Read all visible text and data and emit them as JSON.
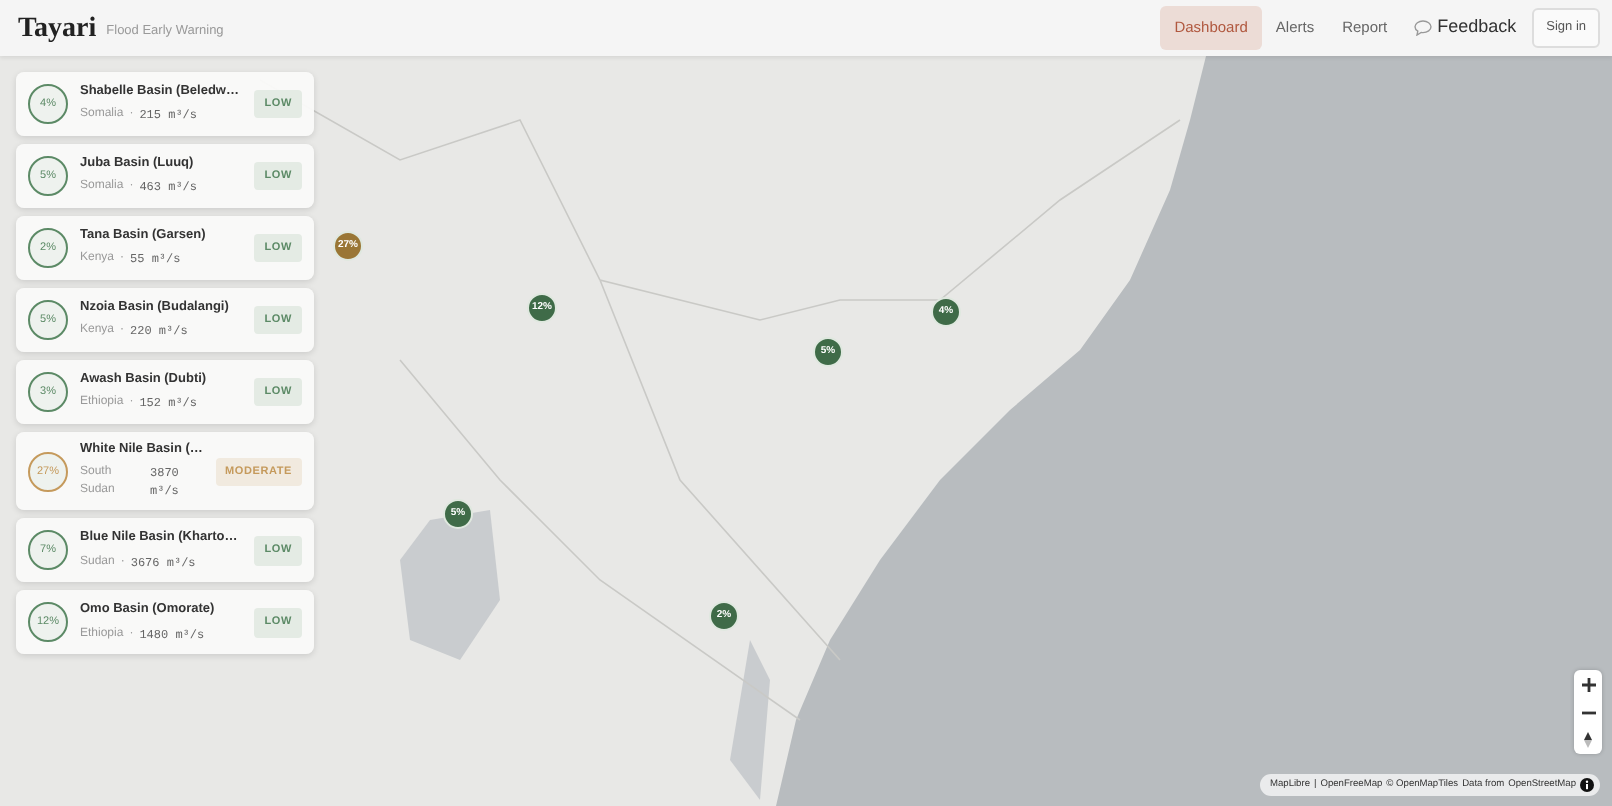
{
  "header": {
    "brand": "Tayari",
    "tagline": "Flood Early Warning",
    "nav": [
      {
        "label": "Dashboard",
        "selected": true
      },
      {
        "label": "Alerts",
        "selected": false
      },
      {
        "label": "Report",
        "selected": false
      }
    ],
    "feedback": "Feedback",
    "signin": "Sign in"
  },
  "basins": [
    {
      "percent": "4%",
      "name": "Shabelle Basin (Beledw…",
      "country": "Somalia",
      "separator": "·",
      "flow": "215 m³/s",
      "color": "#5c8a66",
      "badge": "LOW"
    },
    {
      "percent": "5%",
      "name": "Juba Basin (Luuq)",
      "country": "Somalia",
      "separator": "·",
      "flow": "463 m³/s",
      "color": "#5c8a66",
      "badge": "LOW"
    },
    {
      "percent": "2%",
      "name": "Tana Basin (Garsen)",
      "country": "Kenya",
      "separator": "·",
      "flow": "55 m³/s",
      "color": "#5c8a66",
      "badge": "LOW"
    },
    {
      "percent": "5%",
      "name": "Nzoia Basin (Budalangi)",
      "country": "Kenya",
      "separator": "·",
      "flow": "220 m³/s",
      "color": "#5c8a66",
      "badge": "LOW"
    },
    {
      "percent": "3%",
      "name": "Awash Basin (Dubti)",
      "country": "Ethiopia",
      "separator": "·",
      "flow": "152 m³/s",
      "color": "#5c8a66",
      "badge": "LOW"
    },
    {
      "percent": "27%",
      "name": "White Nile Basin (…",
      "country": "South Sudan",
      "flow": "3870 m³/s",
      "color": "#c59a5c",
      "badge": "MODERATE"
    },
    {
      "percent": "7%",
      "name": "Blue Nile Basin (Kharto…",
      "country": "Sudan",
      "separator": "·",
      "flow": "3676 m³/s",
      "color": "#5c8a66",
      "badge": "LOW"
    },
    {
      "percent": "12%",
      "name": "Omo Basin (Omorate)",
      "country": "Ethiopia",
      "separator": "·",
      "flow": "1480 m³/s",
      "color": "#5c8a66",
      "badge": "LOW"
    }
  ],
  "markers": [
    {
      "label": "27%",
      "color": "#9a7635"
    },
    {
      "label": "12%",
      "color": "#3f6b48"
    },
    {
      "label": "4%",
      "color": "#3f6b48"
    },
    {
      "label": "5%",
      "color": "#3f6b48"
    },
    {
      "label": "5%",
      "color": "#3f6b48"
    },
    {
      "label": "2%",
      "color": "#3f6b48"
    }
  ],
  "attribution": [
    "MapLibre",
    "|",
    "OpenFreeMap",
    "© OpenMapTiles",
    "Data from",
    "OpenStreetMap"
  ]
}
